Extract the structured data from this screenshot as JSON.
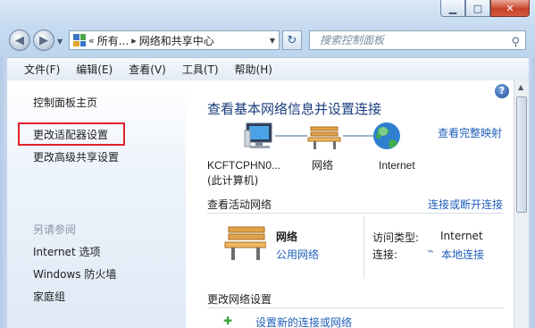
{
  "address": {
    "crumb_first": "所有...",
    "crumb_second": "网络和共享中心",
    "chevrons": "«"
  },
  "search": {
    "placeholder": "搜索控制面板"
  },
  "menu": {
    "file": "文件(F)",
    "edit": "编辑(E)",
    "view": "查看(V)",
    "tools": "工具(T)",
    "help": "帮助(H)"
  },
  "left": {
    "home": "控制面板主页",
    "adapter": "更改适配器设置",
    "advanced": "更改高级共享设置",
    "see_also": "另请参阅",
    "internet_options": "Internet 选项",
    "firewall": "Windows 防火墙",
    "homegroup": "家庭组"
  },
  "main": {
    "title": "查看基本网络信息并设置连接",
    "full_map": "查看完整映射",
    "computer_name": "KCFTCPHN0...",
    "computer_sub": "(此计算机)",
    "network_label": "网络",
    "internet_label": "Internet",
    "active_header": "查看活动网络",
    "connect_link": "连接或断开连接",
    "net_name": "网络",
    "net_type": "公用网络",
    "access_type_label": "访问类型:",
    "access_type_value": "Internet",
    "connection_label": "连接:",
    "connection_value": "本地连接",
    "change_header": "更改网络设置",
    "new_connection": "设置新的连接或网络"
  },
  "colors": {
    "link": "#1f5fb8",
    "title": "#1a3d7c",
    "highlight": "#e0232c"
  },
  "icons": [
    "back-arrow-icon",
    "forward-arrow-icon",
    "control-panel-icon",
    "refresh-icon",
    "search-icon",
    "computer-icon",
    "bench-icon",
    "globe-icon",
    "ethernet-icon",
    "help-icon"
  ]
}
